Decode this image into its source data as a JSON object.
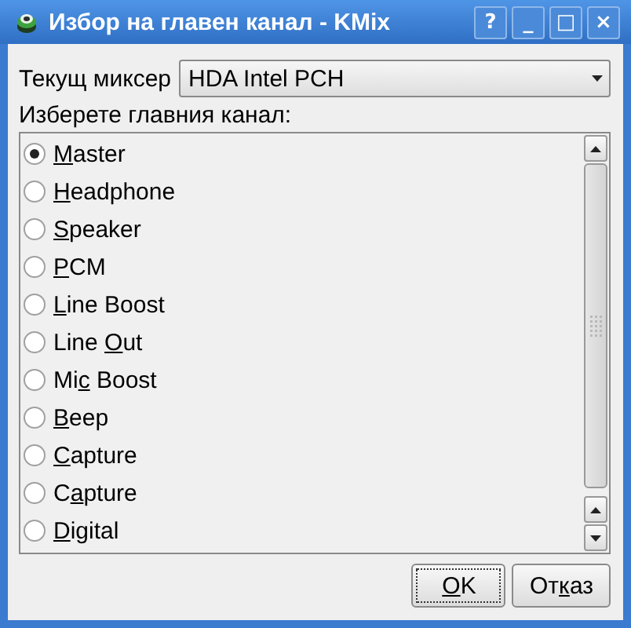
{
  "window": {
    "title": "Избор на главен канал - KMix",
    "controls": [
      "?",
      "_",
      "□",
      "×"
    ]
  },
  "mixer": {
    "label": "Текущ миксер",
    "value": "HDA Intel PCH"
  },
  "channels_label": "Изберете главния канал:",
  "channels": [
    {
      "label": {
        "key": "M",
        "post": "aster"
      },
      "selected": true
    },
    {
      "label": {
        "key": "H",
        "post": "eadphone"
      },
      "selected": false
    },
    {
      "label": {
        "key": "S",
        "post": "peaker"
      },
      "selected": false
    },
    {
      "label": {
        "key": "P",
        "post": "CM"
      },
      "selected": false
    },
    {
      "label": {
        "key": "L",
        "post": "ine Boost"
      },
      "selected": false
    },
    {
      "label": {
        "pre": "Line ",
        "key": "O",
        "post": "ut"
      },
      "selected": false
    },
    {
      "label": {
        "pre": "Mi",
        "key": "c",
        "post": " Boost"
      },
      "selected": false
    },
    {
      "label": {
        "key": "B",
        "post": "eep"
      },
      "selected": false
    },
    {
      "label": {
        "key": "C",
        "post": "apture"
      },
      "selected": false
    },
    {
      "label": {
        "pre": "C",
        "key": "a",
        "post": "pture"
      },
      "selected": false
    },
    {
      "label": {
        "key": "D",
        "post": "igital"
      },
      "selected": false
    }
  ],
  "buttons": [
    {
      "label": {
        "key": "O",
        "post": "K"
      },
      "focused": true
    },
    {
      "label": {
        "pre": "От",
        "key": "к",
        "post": "аз"
      },
      "focused": false
    }
  ]
}
